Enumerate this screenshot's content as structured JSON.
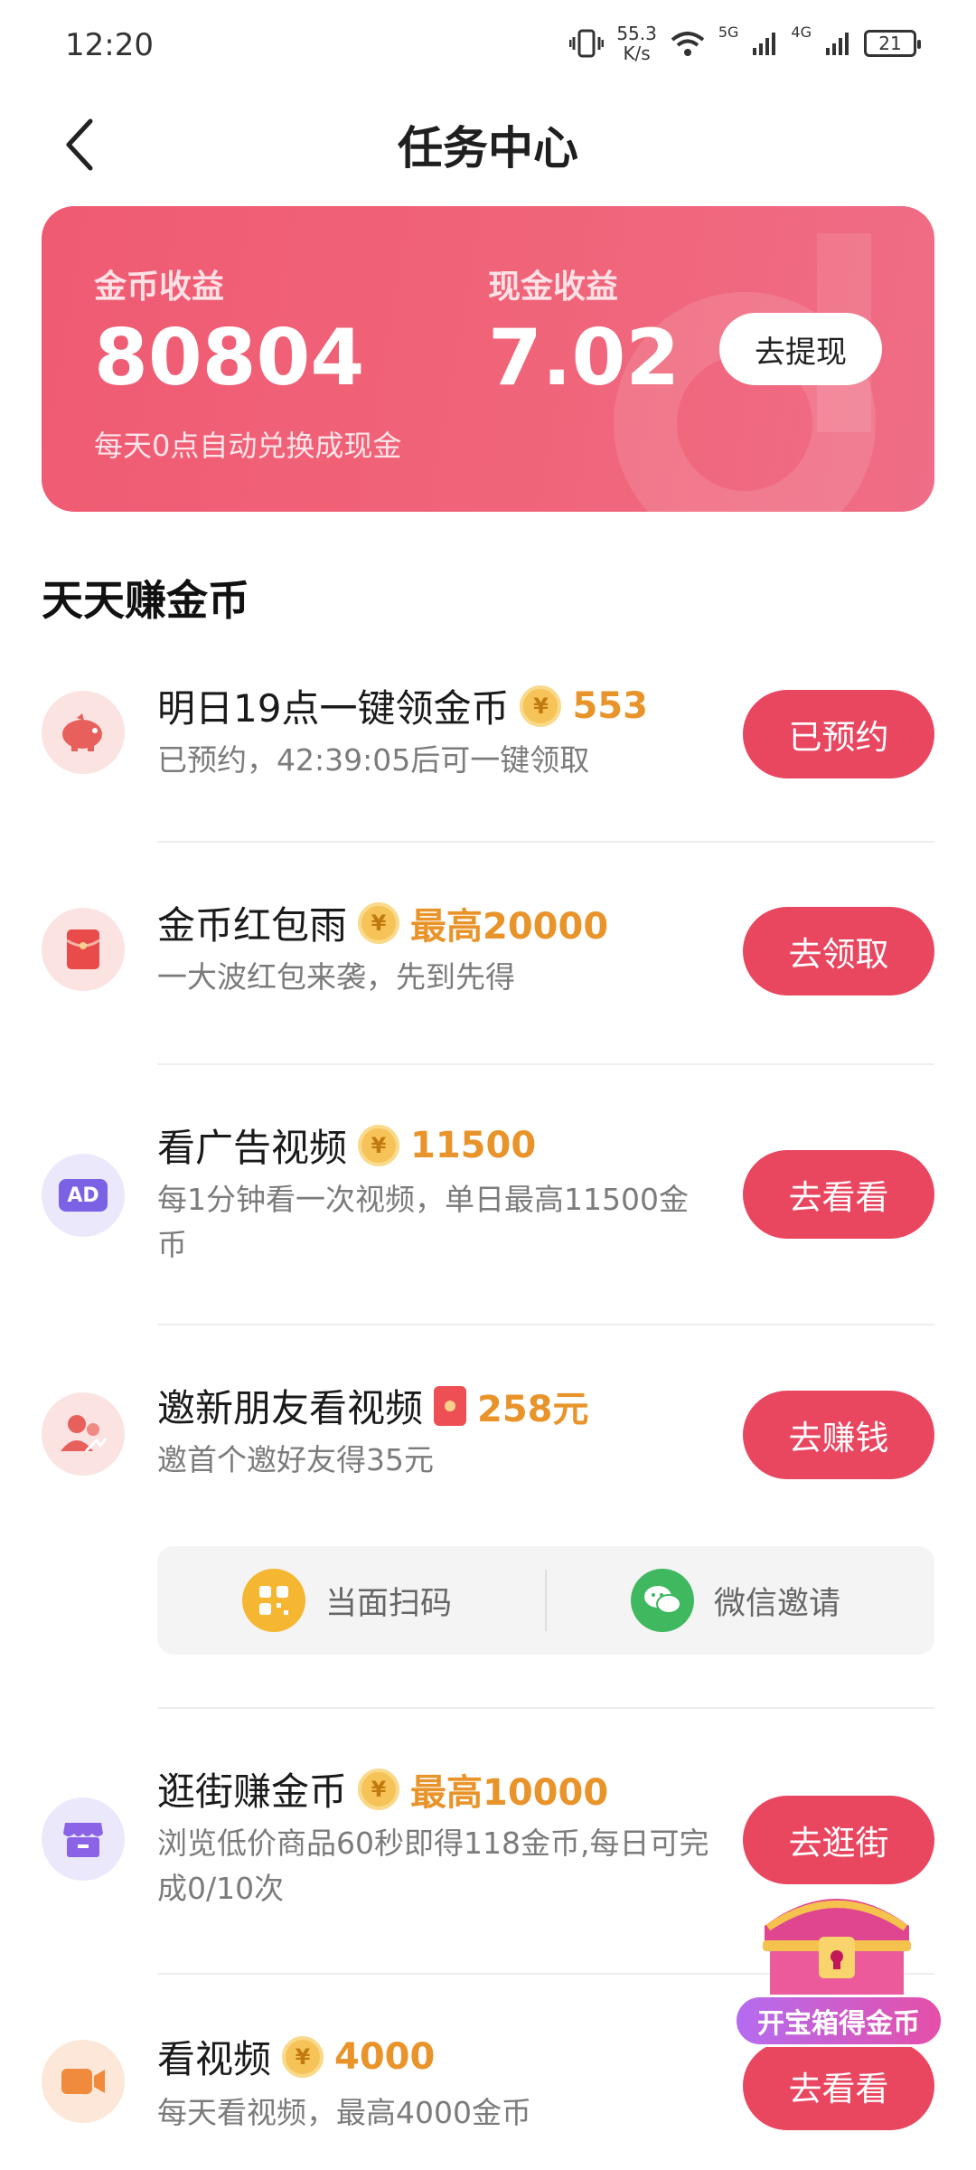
{
  "status_bar": {
    "time": "12:20",
    "net_speed": "55.3",
    "net_unit": "K/s",
    "signal1": "5G",
    "signal2": "4G",
    "battery": "21"
  },
  "header": {
    "title": "任务中心"
  },
  "earnings": {
    "coin_label": "金币收益",
    "coin_value": "80804",
    "cash_label": "现金收益",
    "cash_value": "7.02",
    "withdraw_label": "去提现",
    "note": "每天0点自动兑换成现金"
  },
  "section": {
    "title": "天天赚金币"
  },
  "tasks": [
    {
      "title": "明日19点一键领金币",
      "reward": "553",
      "desc": "已预约，42:39:05后可一键领取",
      "button": "已预约",
      "icon": "piggy-bank-icon",
      "reward_icon": "coin-icon"
    },
    {
      "title": "金币红包雨",
      "reward": "最高20000",
      "desc": "一大波红包来袭，先到先得",
      "button": "去领取",
      "icon": "red-envelope-icon",
      "reward_icon": "coin-icon"
    },
    {
      "title": "看广告视频",
      "reward": "11500",
      "desc": "每1分钟看一次视频，单日最高11500金币",
      "button": "去看看",
      "icon": "ad-icon",
      "reward_icon": "coin-icon",
      "icon_text": "AD"
    },
    {
      "title": "邀新朋友看视频",
      "reward": "258元",
      "desc": "邀首个邀好友得35元",
      "button": "去赚钱",
      "icon": "invite-friends-icon",
      "reward_icon": "red-envelope-icon"
    },
    {
      "title": "逛街赚金币",
      "reward": "最高10000",
      "desc": "浏览低价商品60秒即得118金币,每日可完成0/10次",
      "button": "去逛街",
      "icon": "shop-icon",
      "reward_icon": "coin-icon"
    },
    {
      "title": "看视频",
      "reward": "4000",
      "desc": "每天看视频，最高4000金币",
      "button": "去看看",
      "icon": "video-camera-icon",
      "reward_icon": "coin-icon"
    }
  ],
  "invite": {
    "scan_label": "当面扫码",
    "wechat_label": "微信邀请"
  },
  "floating": {
    "label": "开宝箱得金币"
  },
  "colors": {
    "accent": "#e94660",
    "card": "#ef5b72",
    "reward": "#e8942a"
  }
}
